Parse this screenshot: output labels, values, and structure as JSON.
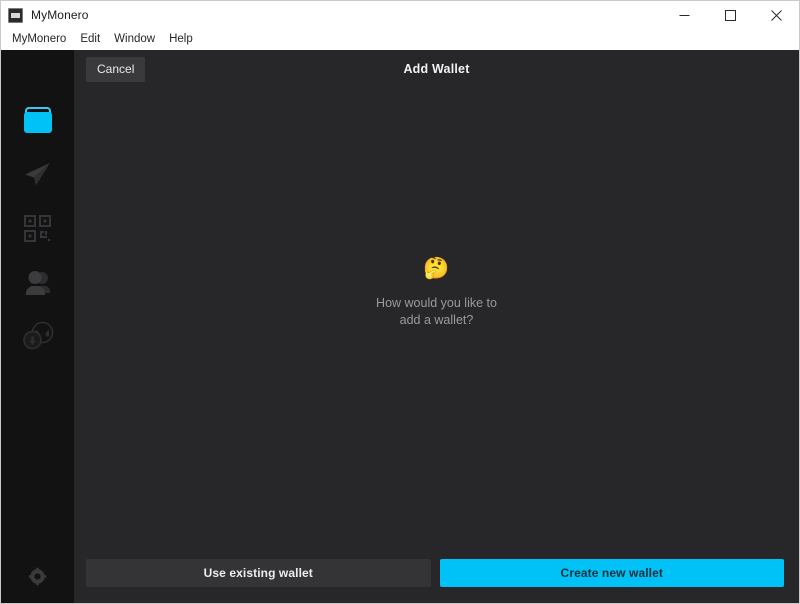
{
  "window": {
    "title": "MyMonero",
    "app_icon": "app-icon",
    "controls": [
      {
        "name": "minimize-button",
        "glyph": "minimize-icon"
      },
      {
        "name": "maximize-button",
        "glyph": "maximize-icon"
      },
      {
        "name": "close-button",
        "glyph": "close-icon"
      }
    ]
  },
  "menubar": {
    "items": [
      {
        "label": "MyMonero"
      },
      {
        "label": "Edit"
      },
      {
        "label": "Window"
      },
      {
        "label": "Help"
      }
    ]
  },
  "sidebar": {
    "background": "#121213",
    "active_color": "#00c2f7",
    "inactive_color": "#333335",
    "items": [
      {
        "label": "Wallets",
        "icon": "wallet-icon",
        "active": true
      },
      {
        "label": "Send",
        "icon": "send-paper-plane-icon",
        "active": false
      },
      {
        "label": "Receive",
        "icon": "qr-code-icon",
        "active": false
      },
      {
        "label": "Contacts",
        "icon": "contacts-person-icon",
        "active": false
      },
      {
        "label": "Exchange",
        "icon": "monero-exchange-icon",
        "active": false
      }
    ],
    "settings": {
      "label": "Settings",
      "icon": "gear-icon"
    }
  },
  "topbar": {
    "cancel_label": "Cancel",
    "title": "Add Wallet"
  },
  "main": {
    "emoji": "🤔",
    "emoji_name": "thinking-face-emoji",
    "prompt_line_1": "How would you like to",
    "prompt_line_2": "add a wallet?"
  },
  "footer": {
    "secondary_label": "Use existing wallet",
    "primary_label": "Create new wallet",
    "primary_color": "#00c2f7",
    "secondary_color": "#343436"
  }
}
